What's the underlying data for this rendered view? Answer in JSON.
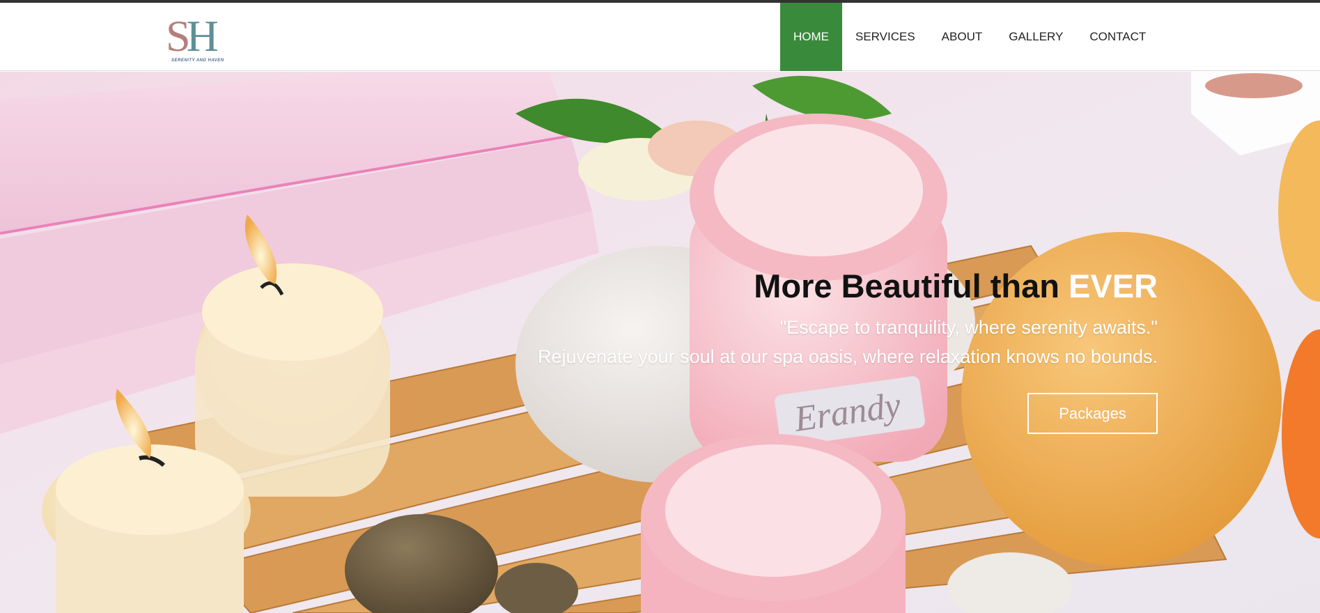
{
  "brand": {
    "logo_letters_s": "S",
    "logo_letters_h": "H",
    "tagline": "SERENITY AND HAVEN"
  },
  "nav": {
    "items": [
      {
        "label": "HOME",
        "active": true
      },
      {
        "label": "SERVICES",
        "active": false
      },
      {
        "label": "ABOUT",
        "active": false
      },
      {
        "label": "GALLERY",
        "active": false
      },
      {
        "label": "CONTACT",
        "active": false
      }
    ]
  },
  "hero": {
    "title_main": "More Beautiful than ",
    "title_accent": "EVER",
    "quote": "\"Escape to tranquility, where serenity awaits.\"",
    "subtitle": "Rejuvenate your soul at our spa oasis, where relaxation knows no bounds.",
    "cta_label": "Packages",
    "jar_brand": "Erandy"
  },
  "colors": {
    "active_nav": "#3a8a3c",
    "accent_title": "#ffffff"
  }
}
